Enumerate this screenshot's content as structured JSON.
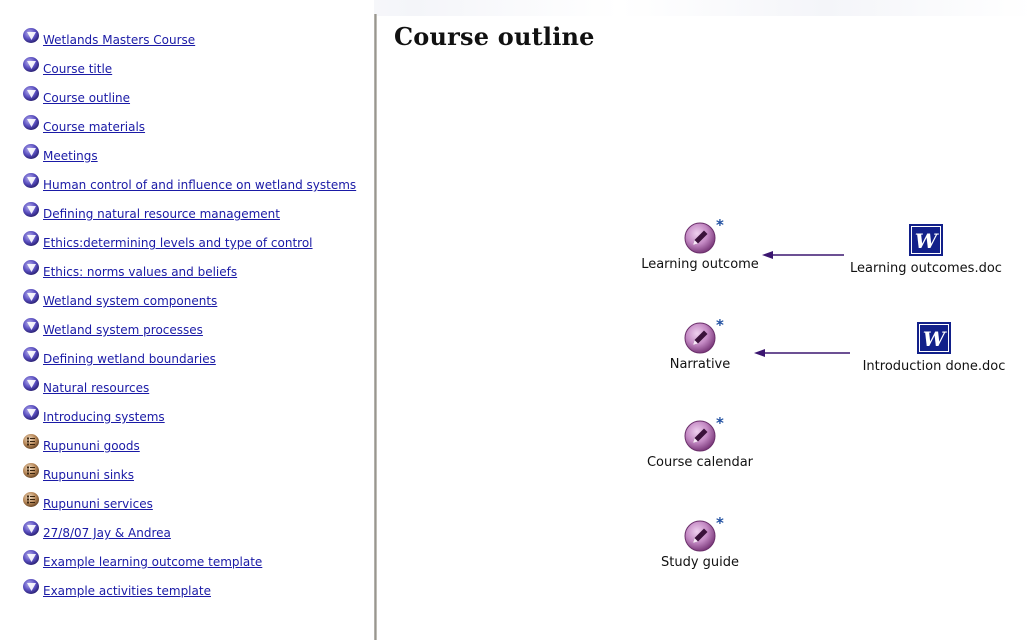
{
  "sidebar": {
    "items": [
      {
        "label": "Wetlands Masters Course",
        "icon": "map-icon"
      },
      {
        "label": "Course title",
        "icon": "map-icon"
      },
      {
        "label": "Course outline",
        "icon": "map-icon"
      },
      {
        "label": "Course materials",
        "icon": "map-icon"
      },
      {
        "label": "Meetings",
        "icon": "map-icon"
      },
      {
        "label": "Human control of and influence on wetland systems",
        "icon": "map-icon"
      },
      {
        "label": "Defining natural resource management",
        "icon": "map-icon"
      },
      {
        "label": "Ethics:determining levels and type of control",
        "icon": "map-icon"
      },
      {
        "label": "Ethics: norms values and beliefs",
        "icon": "map-icon"
      },
      {
        "label": "Wetland system components",
        "icon": "map-icon"
      },
      {
        "label": "Wetland system processes",
        "icon": "map-icon"
      },
      {
        "label": "Defining wetland boundaries",
        "icon": "map-icon"
      },
      {
        "label": "Natural resources",
        "icon": "map-icon"
      },
      {
        "label": "Introducing systems",
        "icon": "map-icon"
      },
      {
        "label": "Rupununi goods",
        "icon": "list-icon"
      },
      {
        "label": "Rupununi sinks",
        "icon": "list-icon"
      },
      {
        "label": "Rupununi services",
        "icon": "list-icon"
      },
      {
        "label": "27/8/07 Jay & Andrea",
        "icon": "map-icon"
      },
      {
        "label": "Example learning outcome template",
        "icon": "map-icon"
      },
      {
        "label": "Example activities template",
        "icon": "map-icon"
      }
    ]
  },
  "main": {
    "title": "Course outline",
    "nodes": [
      {
        "label": "Learning outcome",
        "icon": "note-icon",
        "badge": "*"
      },
      {
        "label": "Narrative",
        "icon": "note-icon",
        "badge": "*"
      },
      {
        "label": "Course calendar",
        "icon": "note-icon",
        "badge": "*"
      },
      {
        "label": "Study guide",
        "icon": "note-icon",
        "badge": "*"
      }
    ],
    "documents": [
      {
        "label": "Learning outcomes.doc",
        "icon": "word-doc-icon",
        "glyph": "W"
      },
      {
        "label": "Introduction done.doc",
        "icon": "word-doc-icon",
        "glyph": "W"
      }
    ],
    "links": [
      {
        "from": "Learning outcomes.doc",
        "to": "Learning outcome"
      },
      {
        "from": "Introduction done.doc",
        "to": "Narrative"
      }
    ]
  },
  "colors": {
    "link_text": "#1a1aa6",
    "arrow": "#3b1670",
    "badge": "#1f4fa0",
    "note_icon": "#b07ab0",
    "word_blue": "#12208a"
  }
}
